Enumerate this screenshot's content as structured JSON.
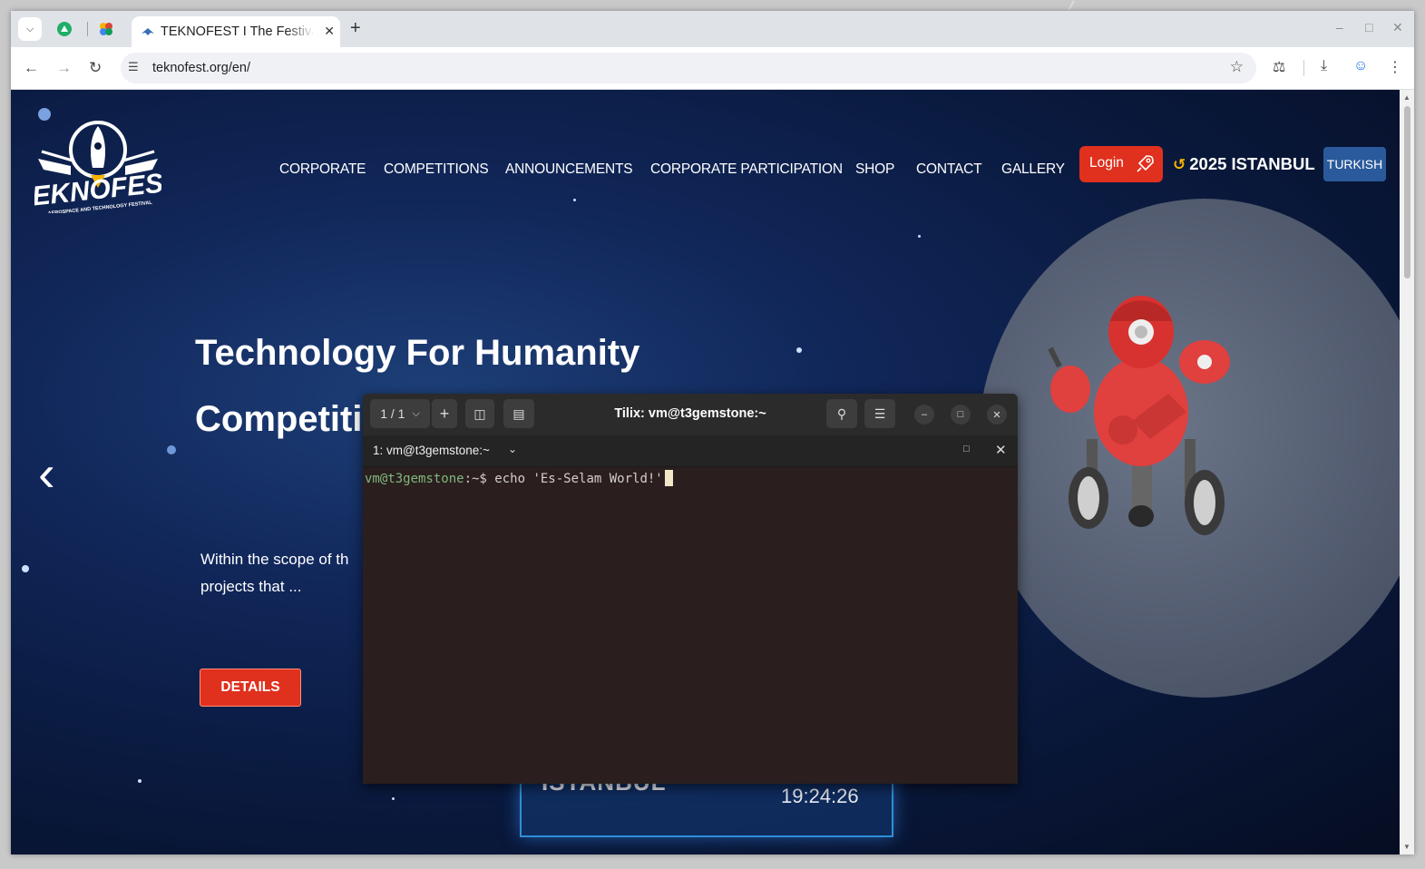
{
  "browser": {
    "tabs": [
      {
        "title": "TEKNOFEST I The Festival of Aerospace and Technology",
        "active": true
      }
    ],
    "url": "teknofest.org/en/"
  },
  "site": {
    "nav": [
      "CORPORATE",
      "COMPETITIONS",
      "ANNOUNCEMENTS",
      "CORPORATE PARTICIPATION",
      "SHOP",
      "CONTACT",
      "GALLERY"
    ],
    "login_label": "Login",
    "year_label": "2025 ISTANBUL",
    "lang_label": "TURKISH",
    "hero": {
      "title_line1": "Technology For Humanity",
      "title_line2": "Competiti",
      "desc_line1": "Within the scope of th",
      "desc_line2": "projects that ...",
      "details_label": "DETAILS"
    },
    "countdown": {
      "city": "ISTANBUL",
      "time": "19:24:26"
    },
    "logo": {
      "name": "TEKNOFEST",
      "tagline": "AEROSPACE AND TECHNOLOGY FESTIVAL"
    }
  },
  "tilix": {
    "title": "Tilix: vm@t3gemstone:~",
    "session_count": "1 / 1",
    "terminal_label": "1: vm@t3gemstone:~",
    "prompt_user": "vm@t3gemstone",
    "prompt_path": ":~$",
    "command": " echo 'Es-Selam World!'"
  },
  "colors": {
    "accent_red": "#e0301e",
    "lang_blue": "#2a5a9b",
    "terminal_bg": "#2a1f1e",
    "year_icon": "#f6b400"
  }
}
